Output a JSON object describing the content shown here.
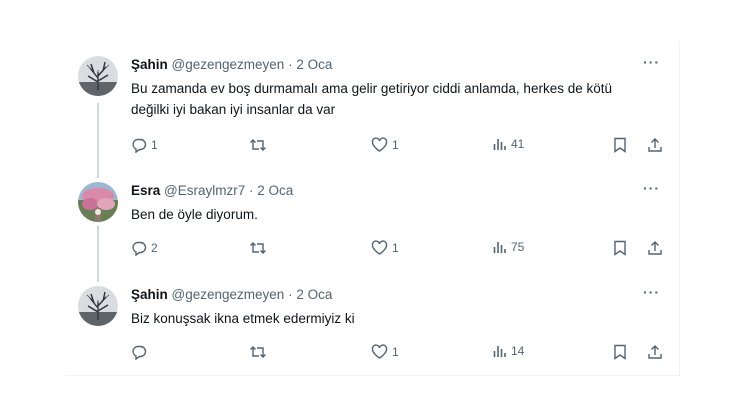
{
  "tweets": [
    {
      "name": "Şahin",
      "handle": "@gezengezmeyen",
      "separator": "·",
      "date": "2 Oca",
      "more": "···",
      "text": "Bu zamanda ev boş durmamalı ama gelir getiriyor ciddi anlamda, herkes de kötü değilki iyi bakan iyi insanlar da var",
      "replies": "1",
      "retweets": "",
      "likes": "1",
      "views": "41",
      "avatar_icon": "tree-avatar"
    },
    {
      "name": "Esra",
      "handle": "@Esraylmzr7",
      "separator": "·",
      "date": "2 Oca",
      "more": "···",
      "text": "Ben de öyle diyorum.",
      "replies": "2",
      "retweets": "",
      "likes": "1",
      "views": "75",
      "avatar_icon": "blossom-avatar"
    },
    {
      "name": "Şahin",
      "handle": "@gezengezmeyen",
      "separator": "·",
      "date": "2 Oca",
      "more": "···",
      "text": "Biz konuşsak ikna etmek edermiyiz ki",
      "replies": "",
      "retweets": "",
      "likes": "1",
      "views": "14",
      "avatar_icon": "tree-avatar"
    }
  ],
  "colors": {
    "text": "#0f1419",
    "secondary": "#536471",
    "thread_line": "#cfd9de"
  }
}
